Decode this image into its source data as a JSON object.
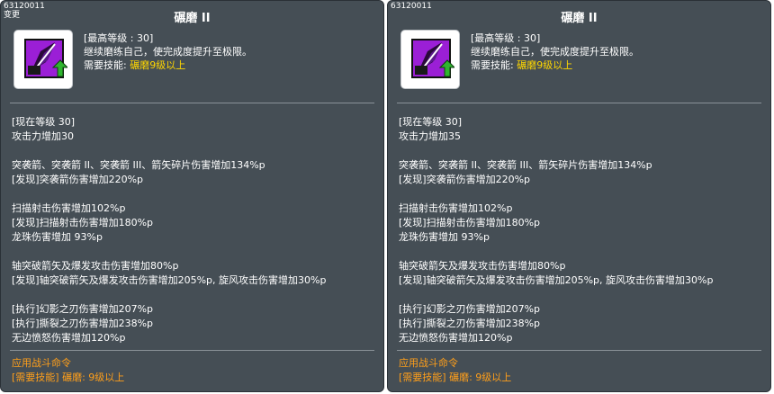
{
  "panels": [
    {
      "id": "63120011",
      "tag": "变更",
      "title": "碾磨 II",
      "max_level": "[最高等级 : 30]",
      "desc": "继续磨练自己，使完成度提升至极限。",
      "req_label": "需要技能: ",
      "req_value": "碾磨9级以上",
      "current_level": "[现在等级 30]",
      "attack": "攻击力增加30",
      "l1": "突袭箭、突袭箭 II、突袭箭 III、箭矢碎片伤害增加134%p",
      "l2": "[发现]突袭箭伤害增加220%p",
      "l3": "扫描射击伤害增加102%p",
      "l4": "[发现]扫描射击伤害增加180%p",
      "l5": "龙珠伤害增加 93%p",
      "l6": "轴突破箭矢及爆发攻击伤害增加80%p",
      "l7": "[发现]轴突破箭矢及爆发攻击伤害增加205%p, 旋风攻击伤害增加30%p",
      "l8": "[执行]幻影之刃伤害增加207%p",
      "l9": "[执行]撕裂之刃伤害增加238%p",
      "l10": "无边愤怒伤害增加120%p",
      "footer1": "应用战斗命令",
      "footer2": "[需要技能] 碾磨: 9级以上"
    },
    {
      "id": "63120011",
      "title": "碾磨 II",
      "max_level": "[最高等级 : 30]",
      "desc": "继续磨练自己，使完成度提升至极限。",
      "req_label": "需要技能: ",
      "req_value": "碾磨9级以上",
      "current_level": "[现在等级 30]",
      "attack": "攻击力增加35",
      "l1": "突袭箭、突袭箭 II、突袭箭 III、箭矢碎片伤害增加134%p",
      "l2": "[发现]突袭箭伤害增加220%p",
      "l3": "扫描射击伤害增加102%p",
      "l4": "[发现]扫描射击伤害增加180%p",
      "l5": "龙珠伤害增加 93%p",
      "l6": "轴突破箭矢及爆发攻击伤害增加80%p",
      "l7": "[发现]轴突破箭矢及爆发攻击伤害增加205%p, 旋风攻击伤害增加30%p",
      "l8": "[执行]幻影之刃伤害增加207%p",
      "l9": "[执行]撕裂之刃伤害增加238%p",
      "l10": "无边愤怒伤害增加120%p",
      "footer1": "应用战斗命令",
      "footer2": "[需要技能] 碾磨: 9级以上"
    }
  ],
  "colors": {
    "panel_bg": "#454e55",
    "highlight_yellow": "#ffd700",
    "highlight_orange": "#ff9f1a",
    "icon_purple": "#9b1fd6",
    "arrow_green": "#2fb52f"
  },
  "icons": {
    "skill": "skill-icon",
    "upgrade": "upgrade-arrow-icon"
  }
}
